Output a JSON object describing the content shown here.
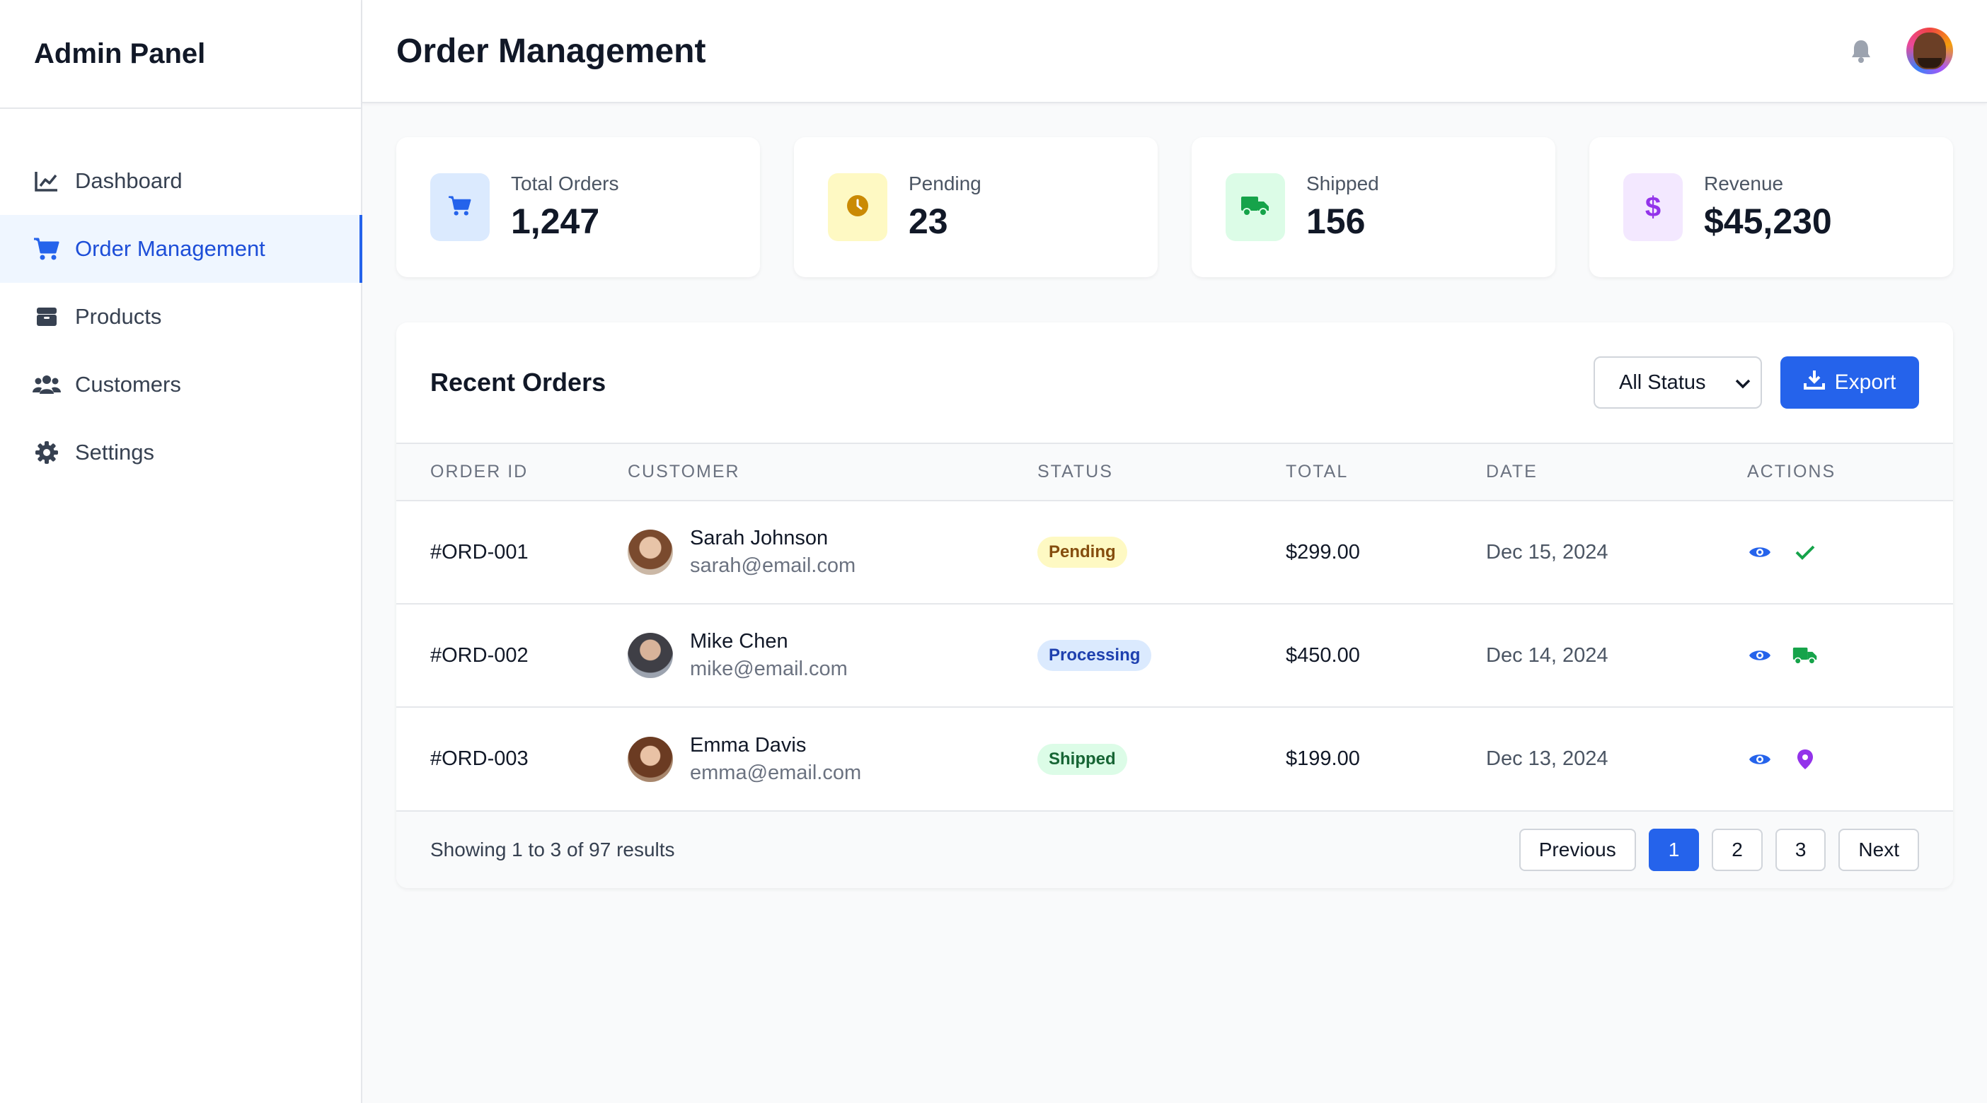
{
  "sidebar": {
    "brand": "Admin Panel",
    "items": [
      {
        "label": "Dashboard",
        "icon": "chart-line-icon"
      },
      {
        "label": "Order Management",
        "icon": "cart-icon",
        "active": true
      },
      {
        "label": "Products",
        "icon": "box-icon"
      },
      {
        "label": "Customers",
        "icon": "users-icon"
      },
      {
        "label": "Settings",
        "icon": "gear-icon"
      }
    ]
  },
  "header": {
    "title": "Order Management",
    "icons": [
      "bell-icon",
      "user-avatar"
    ]
  },
  "stats": [
    {
      "label": "Total Orders",
      "value": "1,247",
      "icon": "cart-icon",
      "bg": "#dbeafe",
      "color": "#2563eb"
    },
    {
      "label": "Pending",
      "value": "23",
      "icon": "clock-icon",
      "bg": "#fef9c3",
      "color": "#ca8a04"
    },
    {
      "label": "Shipped",
      "value": "156",
      "icon": "truck-icon",
      "bg": "#dcfce7",
      "color": "#16a34a"
    },
    {
      "label": "Revenue",
      "value": "$45,230",
      "icon": "dollar-icon",
      "bg": "#f3e8ff",
      "color": "#9333ea"
    }
  ],
  "orders": {
    "title": "Recent Orders",
    "filter": {
      "selected": "All Status"
    },
    "export_label": "Export",
    "columns": [
      "Order ID",
      "Customer",
      "Status",
      "Total",
      "Date",
      "Actions"
    ],
    "rows": [
      {
        "id": "#ORD-001",
        "name": "Sarah Johnson",
        "email": "sarah@email.com",
        "status": "Pending",
        "total": "$299.00",
        "date": "Dec 15, 2024",
        "actions": [
          "view-icon",
          "check-icon"
        ]
      },
      {
        "id": "#ORD-002",
        "name": "Mike Chen",
        "email": "mike@email.com",
        "status": "Processing",
        "total": "$450.00",
        "date": "Dec 14, 2024",
        "actions": [
          "view-icon",
          "truck-icon"
        ]
      },
      {
        "id": "#ORD-003",
        "name": "Emma Davis",
        "email": "emma@email.com",
        "status": "Shipped",
        "total": "$199.00",
        "date": "Dec 13, 2024",
        "actions": [
          "view-icon",
          "map-pin-icon"
        ]
      }
    ],
    "footer": {
      "showing": "Showing 1 to 3 of 97 results",
      "prev": "Previous",
      "pages": [
        "1",
        "2",
        "3"
      ],
      "current_page": "1",
      "next": "Next"
    }
  },
  "colors": {
    "accent": "#2563eb",
    "pending_bg": "#fef9c3",
    "pending_text": "#854d0e",
    "processing_bg": "#dbeafe",
    "processing_text": "#1e40af",
    "shipped_bg": "#dcfce7",
    "shipped_text": "#166534"
  }
}
